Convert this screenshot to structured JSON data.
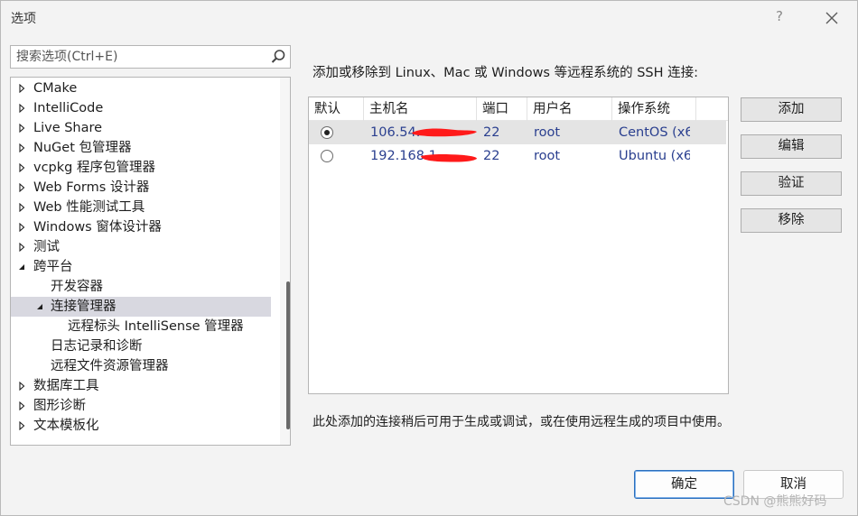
{
  "window": {
    "title": "选项",
    "help_glyph": "?",
    "close_icon": "close-icon"
  },
  "search": {
    "placeholder": "搜索选项(Ctrl+E)",
    "icon": "search-icon"
  },
  "tree": {
    "items": [
      {
        "label": "CMake",
        "state": "collapsed",
        "level": 0
      },
      {
        "label": "IntelliCode",
        "state": "collapsed",
        "level": 0
      },
      {
        "label": "Live Share",
        "state": "collapsed",
        "level": 0
      },
      {
        "label": "NuGet 包管理器",
        "state": "collapsed",
        "level": 0
      },
      {
        "label": "vcpkg 程序包管理器",
        "state": "collapsed",
        "level": 0
      },
      {
        "label": "Web Forms 设计器",
        "state": "collapsed",
        "level": 0
      },
      {
        "label": "Web 性能测试工具",
        "state": "collapsed",
        "level": 0
      },
      {
        "label": "Windows 窗体设计器",
        "state": "collapsed",
        "level": 0
      },
      {
        "label": "测试",
        "state": "collapsed",
        "level": 0
      },
      {
        "label": "跨平台",
        "state": "expanded",
        "level": 0
      },
      {
        "label": "开发容器",
        "state": "leaf",
        "level": 1
      },
      {
        "label": "连接管理器",
        "state": "expanded",
        "level": 1,
        "selected": true
      },
      {
        "label": "远程标头 IntelliSense 管理器",
        "state": "leaf",
        "level": 2
      },
      {
        "label": "日志记录和诊断",
        "state": "leaf",
        "level": 1
      },
      {
        "label": "远程文件资源管理器",
        "state": "leaf",
        "level": 1
      },
      {
        "label": "数据库工具",
        "state": "collapsed",
        "level": 0
      },
      {
        "label": "图形诊断",
        "state": "collapsed",
        "level": 0
      },
      {
        "label": "文本模板化",
        "state": "collapsed",
        "level": 0
      }
    ]
  },
  "main": {
    "description": "添加或移除到 Linux、Mac 或 Windows 等远程系统的 SSH 连接:",
    "columns": [
      "默认",
      "主机名",
      "端口",
      "用户名",
      "操作系统"
    ],
    "rows": [
      {
        "default": true,
        "host": "106.54.",
        "port": "22",
        "user": "root",
        "os": "CentOS (x6",
        "selected": true
      },
      {
        "default": false,
        "host": "192.168.1",
        "port": "22",
        "user": "root",
        "os": "Ubuntu (x6",
        "selected": false
      }
    ],
    "buttons": {
      "add": "添加",
      "edit": "编辑",
      "verify": "验证",
      "remove": "移除"
    },
    "note": "此处添加的连接稍后可用于生成或调试，或在使用远程生成的项目中使用。"
  },
  "footer": {
    "ok": "确定",
    "cancel": "取消"
  },
  "watermark": "CSDN @熊熊好码",
  "colors": {
    "link_text": "#2a3f8f",
    "redaction": "#ff1a1a",
    "ok_border": "#2a6fbd"
  }
}
